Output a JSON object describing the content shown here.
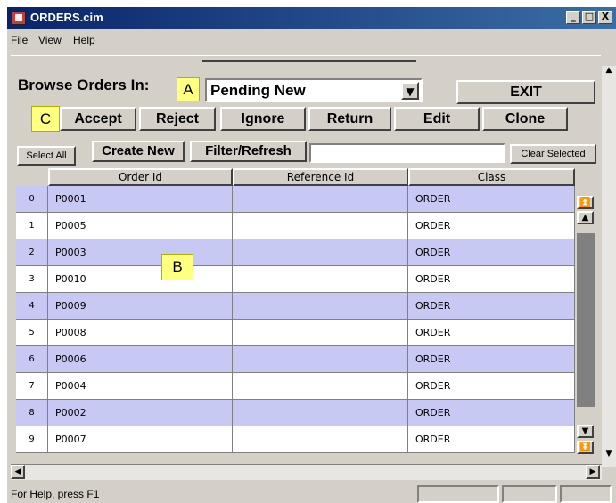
{
  "window": {
    "title": "ORDERS.cim",
    "min_btn": "_",
    "max_btn": "□",
    "close_btn": "X"
  },
  "menu": [
    "File",
    "View",
    "Help"
  ],
  "browse": {
    "label": "Browse Orders In:",
    "selected": "Pending New",
    "marker_a": "A"
  },
  "actions": {
    "marker_c": "C",
    "accept": "Accept",
    "reject": "Reject",
    "ignore": "Ignore",
    "return": "Return",
    "edit": "Edit",
    "clone": "Clone",
    "exit": "EXIT"
  },
  "toolbar2": {
    "select_all": "Select All",
    "create_new": "Create New",
    "filter_refresh": "Filter/Refresh",
    "filter_value": "",
    "clear_selected": "Clear Selected"
  },
  "table": {
    "columns": [
      "Order Id",
      "Reference Id",
      "Class"
    ],
    "marker_b": "B",
    "rows": [
      {
        "n": "0",
        "order_id": "P0001",
        "reference_id": "",
        "class": "ORDER"
      },
      {
        "n": "1",
        "order_id": "P0005",
        "reference_id": "",
        "class": "ORDER"
      },
      {
        "n": "2",
        "order_id": "P0003",
        "reference_id": "",
        "class": "ORDER"
      },
      {
        "n": "3",
        "order_id": "P0010",
        "reference_id": "",
        "class": "ORDER"
      },
      {
        "n": "4",
        "order_id": "P0009",
        "reference_id": "",
        "class": "ORDER"
      },
      {
        "n": "5",
        "order_id": "P0008",
        "reference_id": "",
        "class": "ORDER"
      },
      {
        "n": "6",
        "order_id": "P0006",
        "reference_id": "",
        "class": "ORDER"
      },
      {
        "n": "7",
        "order_id": "P0004",
        "reference_id": "",
        "class": "ORDER"
      },
      {
        "n": "8",
        "order_id": "P0002",
        "reference_id": "",
        "class": "ORDER"
      },
      {
        "n": "9",
        "order_id": "P0007",
        "reference_id": "",
        "class": "ORDER"
      }
    ]
  },
  "status": {
    "text": "For Help, press F1"
  },
  "icons": {
    "app": "orders-app-icon",
    "dropdown": "triangle-down-icon",
    "scroll_top": "double-up-arrow-icon",
    "scroll_up": "up-arrow-icon",
    "scroll_down": "down-arrow-icon",
    "scroll_bottom": "double-down-arrow-icon"
  },
  "colors": {
    "title_bar": "#0a246a",
    "row_highlight": "#c8c8f4",
    "marker": "#ffff80",
    "window_face": "#d4d0c8"
  }
}
